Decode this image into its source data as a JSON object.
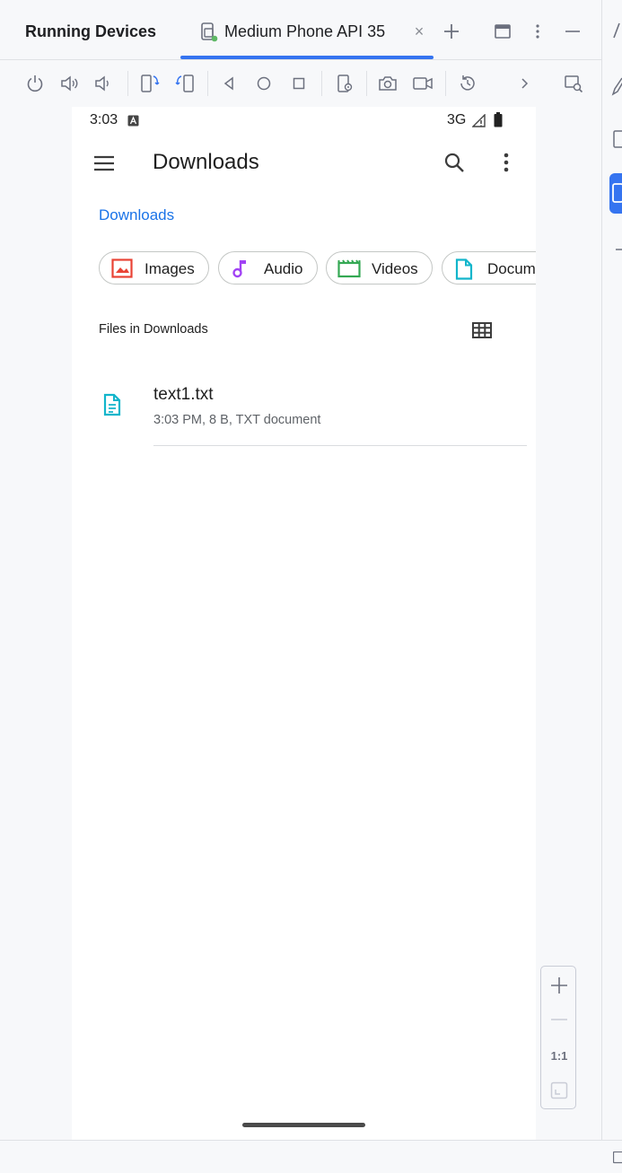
{
  "window": {
    "title": "Running Devices",
    "tab_label": "Medium Phone API 35",
    "tab_close": "×",
    "accent": "#3574f0"
  },
  "toolbar": {
    "icons": [
      "power-icon",
      "volume-up-icon",
      "volume-down-icon",
      "rotate-left-icon",
      "rotate-right-icon",
      "back-icon",
      "home-icon",
      "overview-icon",
      "device-settings-icon",
      "screenshot-icon",
      "screen-record-icon",
      "reset-icon",
      "more-chevron-icon",
      "zoom-inspect-icon"
    ]
  },
  "phone": {
    "status": {
      "time": "3:03",
      "network": "3G"
    },
    "appbar": {
      "title": "Downloads"
    },
    "breadcrumb": "Downloads",
    "chips": [
      {
        "label": "Images",
        "color": "#e94335"
      },
      {
        "label": "Audio",
        "color": "#a142f4"
      },
      {
        "label": "Videos",
        "color": "#34a853"
      },
      {
        "label": "Docum",
        "color": "#12b5cb"
      }
    ],
    "section_title": "Files in Downloads",
    "files": [
      {
        "name": "text1.txt",
        "meta": "3:03 PM, 8 B, TXT document",
        "icon_color": "#12b5cb"
      }
    ]
  },
  "zoom": {
    "fit_label": "1:1"
  }
}
